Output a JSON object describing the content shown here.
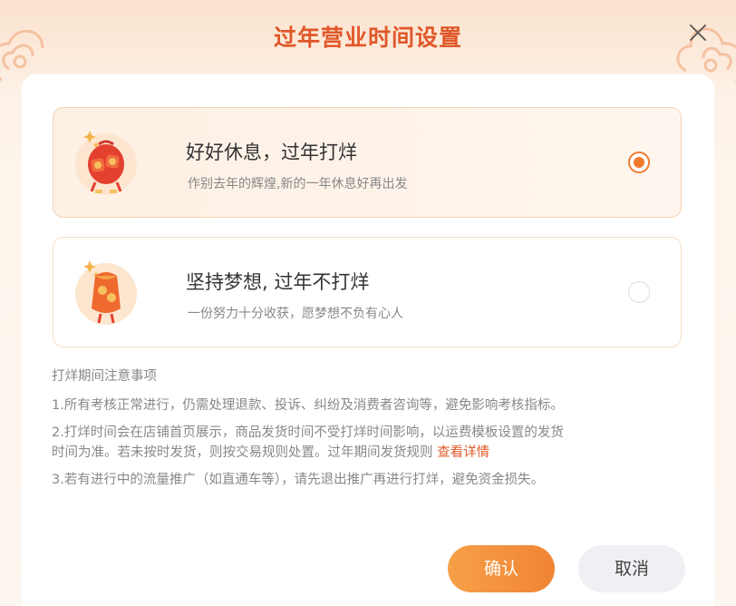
{
  "dialog": {
    "title": "过年营业时间设置",
    "close_icon": "close-icon"
  },
  "options": [
    {
      "title": "好好休息，过年打烊",
      "description": "作别去年的辉煌,新的一年休息好再出发",
      "icon": "lantern-icon",
      "selected": true
    },
    {
      "title": "坚持梦想, 过年不打烊",
      "description": "一份努力十分收获，愿梦想不负有心人",
      "icon": "lantern-icon",
      "selected": false
    }
  ],
  "notes": {
    "title": "打烊期间注意事项",
    "item1": "1.所有考核正常进行，仍需处理退款、投诉、纠纷及消费者咨询等，避免影响考核指标。",
    "item2_line1": "2.打烊时间会在店铺首页展示，商品发货时间不受打烊时间影响，以运费模板设置的发货",
    "item2_line2": "时间为准。若未按时发货，则按交易规则处置。过年期间发货规则 ",
    "item2_link": "查看详情",
    "item3": "3.若有进行中的流量推广（如直通车等），请先退出推广再进行打烊，避免资金损失。"
  },
  "buttons": {
    "confirm": "确认",
    "cancel": "取消"
  },
  "colors": {
    "accent": "#ef7a2e",
    "title": "#e0582a",
    "link": "#e0582a",
    "background_top": "#fbe3cf"
  }
}
